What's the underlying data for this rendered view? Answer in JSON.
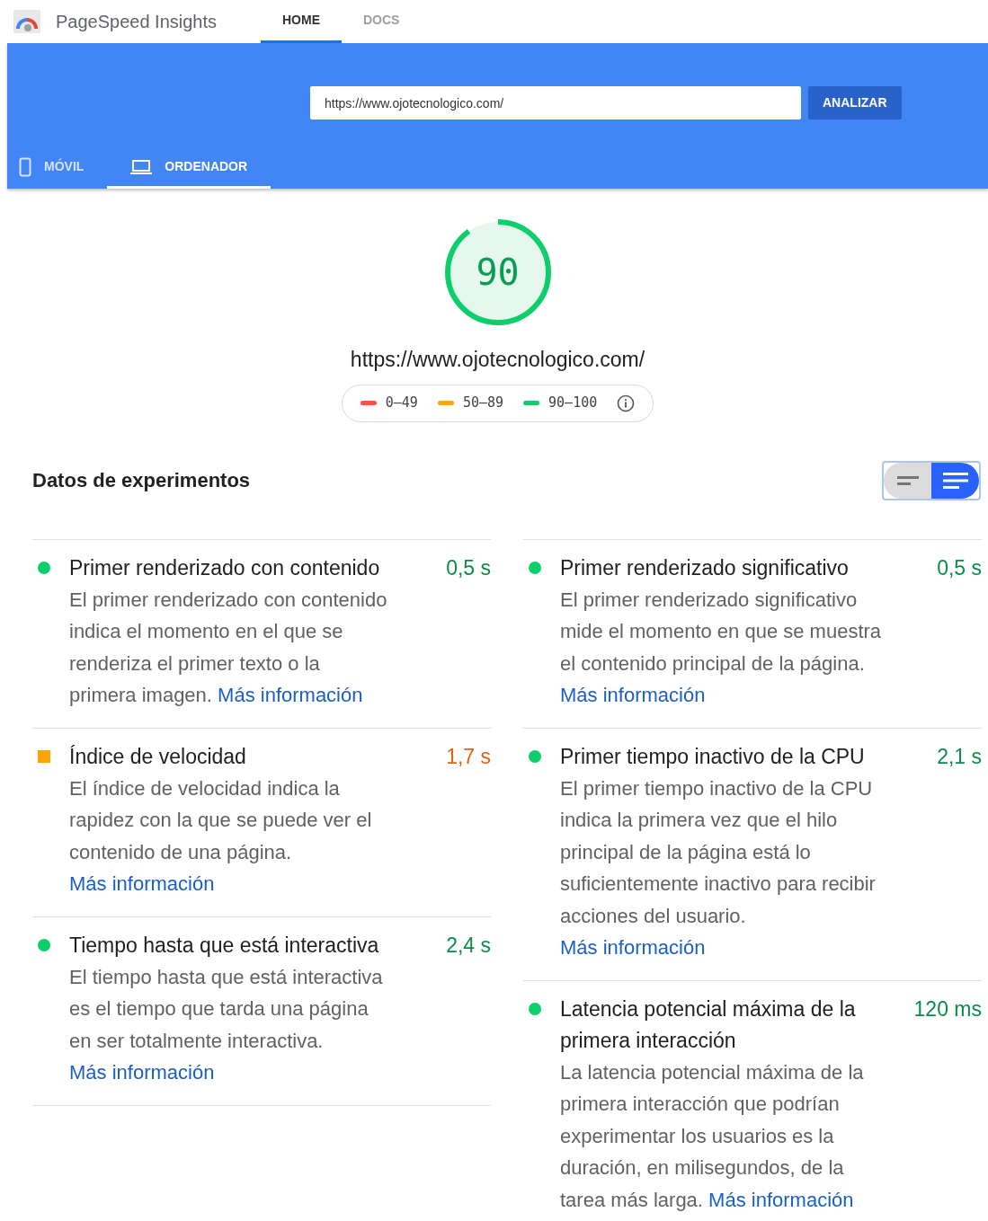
{
  "header": {
    "title": "PageSpeed Insights",
    "nav": [
      {
        "label": "HOME",
        "selected": true
      },
      {
        "label": "DOCS",
        "selected": false
      }
    ]
  },
  "search": {
    "value": "https://www.ojotecnologico.com/",
    "button": "ANALIZAR"
  },
  "device_tabs": [
    {
      "label": "MÓVIL",
      "kind": "phone",
      "selected": false
    },
    {
      "label": "ORDENADOR",
      "kind": "laptop",
      "selected": true
    }
  ],
  "score": {
    "value": "90",
    "level": 0.9,
    "url": "https://www.ojotecnologico.com/"
  },
  "legend": [
    {
      "label": "0–49",
      "color": "#ff4e42"
    },
    {
      "label": "50–89",
      "color": "#ffa400"
    },
    {
      "label": "90–100",
      "color": "#0cce6b"
    }
  ],
  "section": {
    "title": "Datos de experimentos",
    "view_toggle": [
      {
        "kind": "compact",
        "selected": false
      },
      {
        "kind": "expanded",
        "selected": true
      }
    ]
  },
  "metrics": [
    [
      {
        "kind": "pass",
        "title": "Primer renderizado con contenido",
        "value": "0,5 s",
        "description": "El primer renderizado con contenido indica el momento en el que se renderiza el primer texto o la primera imagen.",
        "link": "Más información"
      },
      {
        "kind": "average",
        "title": "Índice de velocidad",
        "value": "1,7 s",
        "description": "El índice de velocidad indica la rapidez con la que se puede ver el contenido de una página.",
        "link": "Más información"
      },
      {
        "kind": "pass",
        "title": "Tiempo hasta que está interactiva",
        "value": "2,4 s",
        "description": "El tiempo hasta que está interactiva es el tiempo que tarda una página en ser totalmente interactiva.",
        "link": "Más información"
      }
    ],
    [
      {
        "kind": "pass",
        "title": "Primer renderizado significativo",
        "value": "0,5 s",
        "description": "El primer renderizado significativo mide el momento en que se muestra el contenido principal de la página.",
        "link": "Más información"
      },
      {
        "kind": "pass",
        "title": "Primer tiempo inactivo de la CPU",
        "value": "2,1 s",
        "description": "El primer tiempo inactivo de la CPU indica la primera vez que el hilo principal de la página está lo suficientemente inactivo para recibir acciones del usuario.",
        "link": "Más información"
      },
      {
        "kind": "pass",
        "title": "Latencia potencial máxima de la primera interacción",
        "value": "120 ms",
        "description": "La latencia potencial máxima de la primera interacción que podrían experimentar los usuarios es la duración, en milisegundos, de la tarea más larga.",
        "link": "Más información"
      }
    ]
  ]
}
